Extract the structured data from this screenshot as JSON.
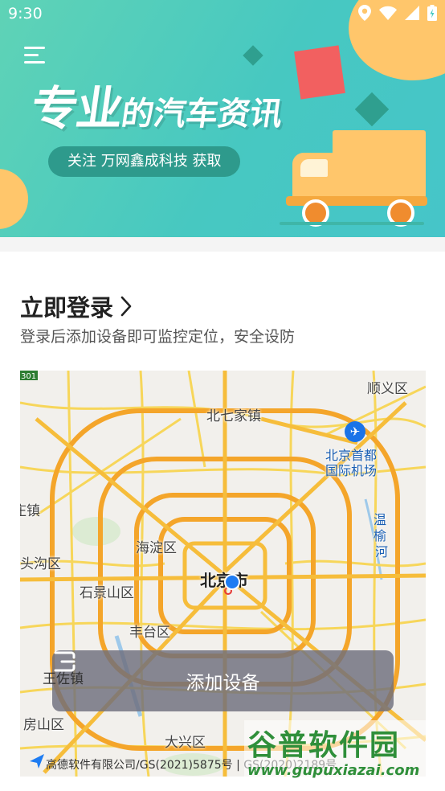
{
  "status_bar": {
    "time": "9:30"
  },
  "banner": {
    "headline_big": "专业",
    "headline_small": "的汽车资讯",
    "pill_text": "关注 万网鑫成科技 获取"
  },
  "login": {
    "title": "立即登录",
    "subtitle": "登录后添加设备即可监控定位，安全设防"
  },
  "map": {
    "labels": {
      "shunyi": "顺义区",
      "beiqijia": "北七家镇",
      "airport_l1": "北京首都",
      "airport_l2": "国际机场",
      "wenyu_1": "温",
      "wenyu_2": "榆",
      "wenyu_3": "河",
      "zhuang": "王庄镇",
      "mentougou": "头沟区",
      "haidian": "海淀区",
      "shijingshan": "石景山区",
      "beijing": "北京市",
      "fengtai": "丰台区",
      "wangzuo": "王佐镇",
      "fangshan": "房山区",
      "daxing": "大兴区",
      "route": "301"
    },
    "add_device_label": "添加设备",
    "attribution": "高德软件有限公司/GS(2021)5875号 | GS(2020)2189号"
  },
  "watermark": {
    "title": "谷普软件园",
    "url": "www.gupuxiazai.com"
  },
  "icons": {
    "location": "location-icon",
    "wifi": "wifi-icon",
    "signal": "signal-icon",
    "battery": "battery-icon",
    "menu": "menu-icon",
    "chevron": "chevron-right-icon",
    "device": "device-icon",
    "airport": "airport-icon",
    "navigation": "navigation-arrow-icon"
  },
  "colors": {
    "banner": "#47c8c1",
    "accent_yellow": "#ffc66b",
    "pill": "#2e9a8c",
    "accent_red": "#f26060",
    "road_major": "#f4a52a",
    "road_minor": "#f7d65a",
    "location_dot": "#1e7cf2"
  }
}
